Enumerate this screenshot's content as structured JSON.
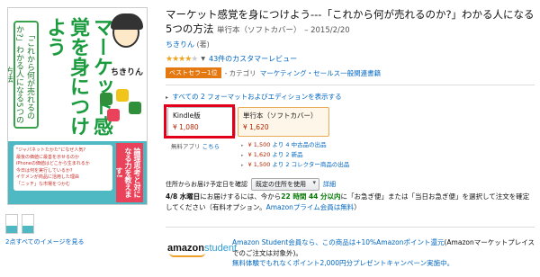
{
  "product": {
    "title": "マーケット感覚を身につけよう---「これから何が売れるのか?」わかる人になる5つの方法",
    "format_label": "単行本（ソフトカバー）",
    "date": "– 2015/2/20",
    "author": "ちきりん",
    "author_role": "(著)",
    "rating": {
      "stars": 4,
      "review_count_text": "43件のカスタマーレビュー"
    },
    "bestseller": {
      "badge": "ベストセラー1位",
      "prefix": "- カテゴリ",
      "category": "マーケティング・セールス一般関連書籍"
    }
  },
  "cover": {
    "title_vertical": "マーケット感覚を身につけよう",
    "subtitle_vertical": "「これから何が売れるのか?」わかる人になる5つの方法",
    "author": "ちきりん",
    "bullets": [
      "\"ジャパネットたかた\"になぜ人気?",
      "最後の価値に最善を示せるのか",
      "iPhoneの価値はどこから生まれるか",
      "今日は何を実行しているか?",
      "イケメンが商品に活用した理由",
      "「ニッチ」な市場をつかむ"
    ],
    "callout": "論理思考と対になる力を教えます!"
  },
  "images": {
    "see_all": "2点すべてのイメージを見る"
  },
  "formats": {
    "show_all_text": "すべての 2 フォーマットおよびエディションを表示する",
    "kindle": {
      "name": "Kindle版",
      "price": "¥ 1,080"
    },
    "paperback": {
      "name": "単行本（ソフトカバー）",
      "price": "¥ 1,620"
    },
    "kindle_app_label": "無料アプリ",
    "kindle_app_link": "こちら",
    "offers": [
      {
        "price": "¥ 1,500",
        "count": "より 4 中古品の出品"
      },
      {
        "price": "¥ 1,620",
        "count": "より 2 新品"
      },
      {
        "price": "¥ 1,500",
        "count": "より 2 コレクター商品の出品"
      }
    ]
  },
  "delivery": {
    "label": "住所からお届け予定日を確認",
    "select_value": "既定の住所を使用",
    "details_link": "詳細",
    "date": "4/8 水曜日",
    "text_1": "にお届けするには、今から",
    "time_left": "22 時間 44 分以内",
    "text_2": "に「お急ぎ便」または「当日お急ぎ便」を選択して注文を確定してください（有料オプション。",
    "prime_link": "Amazonプライム会員は無料",
    "text_3": "）"
  },
  "student": {
    "logo_amazon": "amazon",
    "logo_student": "student",
    "line_1_link": "Amazon Student会員なら、この商品は+10%Amazonポイント還元",
    "line_1_rest": "(Amazonマーケットプレイスでのご注文は対象外)。",
    "line_2_link": "無料体験でもれなくポイント2,000円分プレゼントキャンペーン実施中。"
  },
  "colors": {
    "link": "#0066c0",
    "price": "#b12704",
    "badge": "#e47911",
    "highlight": "#e3001b",
    "star": "#f0a41d"
  }
}
